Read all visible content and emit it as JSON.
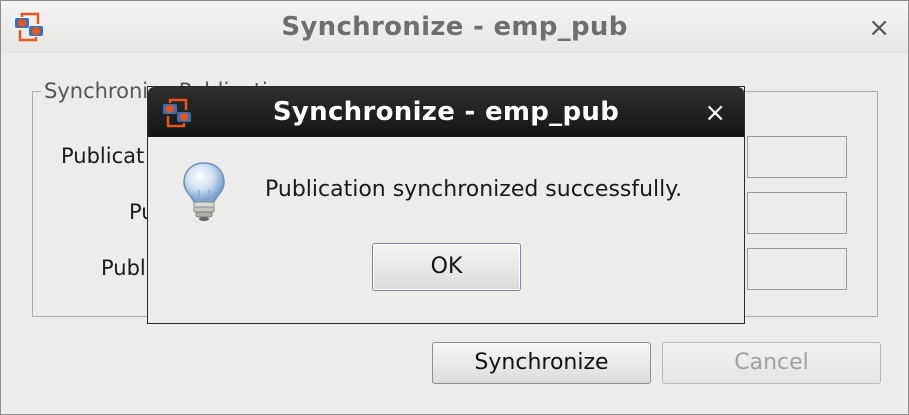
{
  "outer_window": {
    "title": "Synchronize - emp_pub",
    "close_glyph": "×",
    "group_legend": "Synchronize Publication",
    "rows": [
      {
        "label": "Publicat"
      },
      {
        "label": "Pu"
      },
      {
        "label": "Publ"
      }
    ],
    "buttons": {
      "synchronize": "Synchronize",
      "cancel": "Cancel"
    }
  },
  "message_dialog": {
    "title": "Synchronize - emp_pub",
    "close_glyph": "×",
    "message": "Publication synchronized successfully.",
    "ok_label": "OK",
    "icon": "lightbulb-icon"
  },
  "colors": {
    "dialog_titlebar": "#1f1f1f",
    "icon_orange": "#e8551d",
    "icon_blue": "#3b6fb6"
  }
}
